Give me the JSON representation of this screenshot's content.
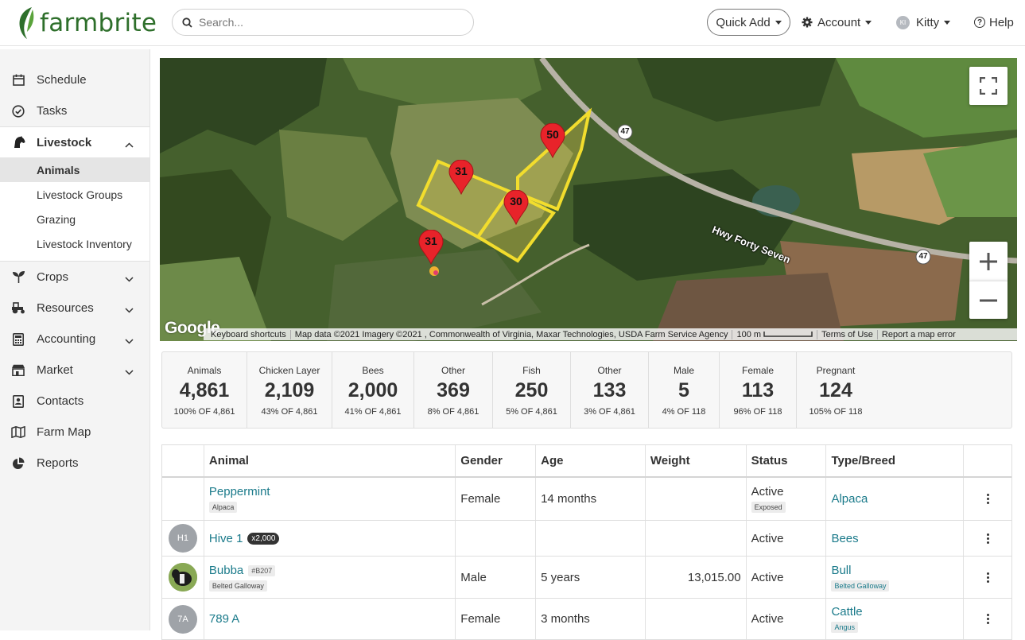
{
  "brand": {
    "name": "farmbrite",
    "color": "#2e6f2b"
  },
  "header": {
    "search_placeholder": "Search...",
    "quick_add": "Quick Add",
    "account": "Account",
    "user_initials": "KI",
    "user_name": "Kitty",
    "help": "Help"
  },
  "sidebar": {
    "schedule": "Schedule",
    "tasks": "Tasks",
    "livestock": "Livestock",
    "livestock_sub": [
      "Animals",
      "Livestock Groups",
      "Grazing",
      "Livestock Inventory"
    ],
    "crops": "Crops",
    "resources": "Resources",
    "accounting": "Accounting",
    "market": "Market",
    "contacts": "Contacts",
    "farm_map": "Farm Map",
    "reports": "Reports"
  },
  "map": {
    "markers": [
      "50",
      "31",
      "30",
      "31"
    ],
    "road_label": "Hwy Forty Seven",
    "route_shield": "47",
    "google": "Google",
    "footer": [
      "Keyboard shortcuts",
      "Map data ©2021 Imagery ©2021 , Commonwealth of Virginia, Maxar Technologies, USDA Farm Service Agency",
      "100 m",
      "Terms of Use",
      "Report a map error"
    ]
  },
  "stats": [
    {
      "label": "Animals",
      "value": "4,861",
      "sub": "100% OF 4,861"
    },
    {
      "label": "Chicken Layer",
      "value": "2,109",
      "sub": "43% OF 4,861"
    },
    {
      "label": "Bees",
      "value": "2,000",
      "sub": "41% OF 4,861"
    },
    {
      "label": "Other",
      "value": "369",
      "sub": "8% OF 4,861"
    },
    {
      "label": "Fish",
      "value": "250",
      "sub": "5% OF 4,861"
    },
    {
      "label": "Other",
      "value": "133",
      "sub": "3% OF 4,861"
    },
    {
      "label": "Male",
      "value": "5",
      "sub": "4% OF 118"
    },
    {
      "label": "Female",
      "value": "113",
      "sub": "96% OF 118"
    },
    {
      "label": "Pregnant",
      "value": "124",
      "sub": "105% OF 118"
    }
  ],
  "table": {
    "columns": [
      "Animal",
      "Gender",
      "Age",
      "Weight",
      "Status",
      "Type/Breed"
    ],
    "rows": [
      {
        "avatar": "",
        "name": "Peppermint",
        "tag": "Alpaca",
        "badge": "",
        "id": "",
        "gender": "Female",
        "age": "14 months",
        "weight": "",
        "status": "Active",
        "status_tag": "Exposed",
        "type": "Alpaca",
        "breed": ""
      },
      {
        "avatar": "H1",
        "name": "Hive 1",
        "tag": "",
        "badge": "x2,000",
        "id": "",
        "gender": "",
        "age": "",
        "weight": "",
        "status": "Active",
        "status_tag": "",
        "type": "Bees",
        "breed": ""
      },
      {
        "avatar": "photo",
        "name": "Bubba",
        "tag": "Belted Galloway",
        "badge": "",
        "id": "#B207",
        "gender": "Male",
        "age": "5 years",
        "weight": "13,015.00",
        "status": "Active",
        "status_tag": "",
        "type": "Bull",
        "breed": "Belted Galloway"
      },
      {
        "avatar": "7A",
        "name": "789 A",
        "tag": "",
        "badge": "",
        "id": "",
        "gender": "Female",
        "age": "3 months",
        "weight": "",
        "status": "Active",
        "status_tag": "",
        "type": "Cattle",
        "breed": "Angus"
      }
    ]
  }
}
